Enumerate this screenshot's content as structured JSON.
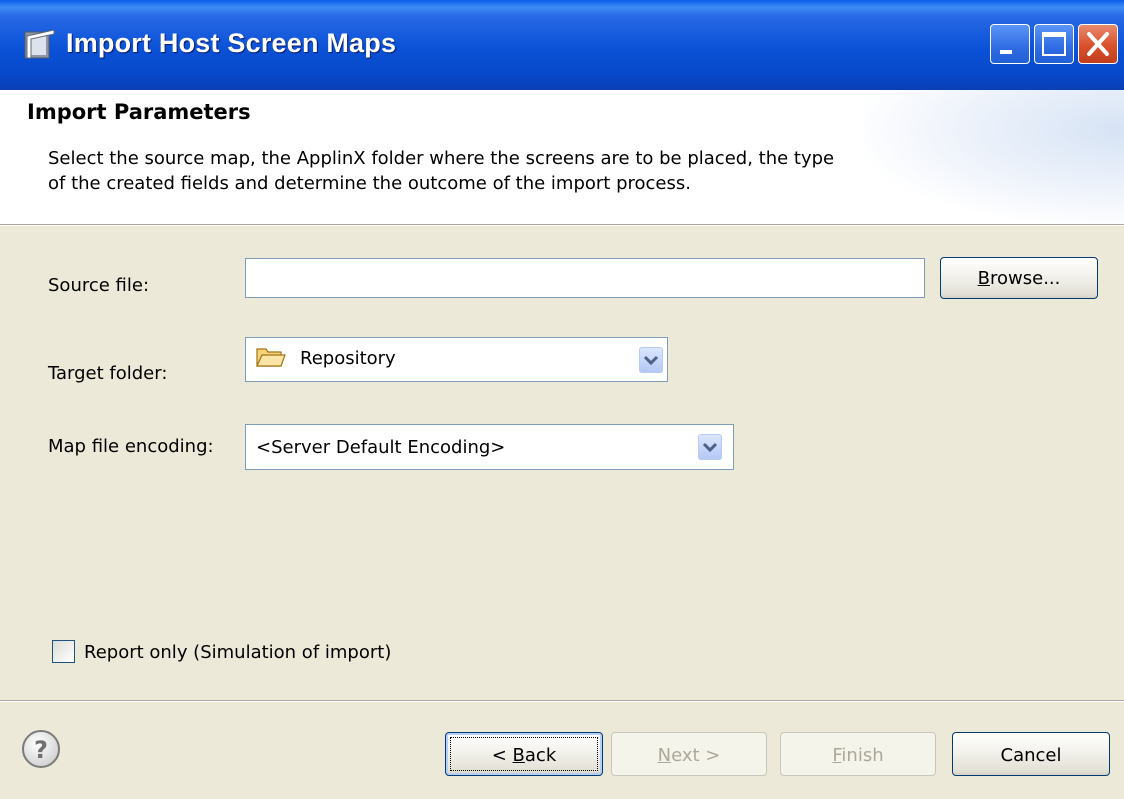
{
  "window": {
    "title": "Import Host Screen Maps"
  },
  "header": {
    "title": "Import Parameters",
    "description_line1": "Select the source map, the ApplinX folder where the screens are to be placed, the type",
    "description_line2": "of the created fields and determine the outcome of the import process."
  },
  "form": {
    "source_file": {
      "label": "Source file:",
      "value": "",
      "browse_label": "Browse..."
    },
    "target_folder": {
      "label": "Target folder:",
      "value": "Repository"
    },
    "map_file_encoding": {
      "label": "Map file encoding:",
      "value": "<Server Default Encoding>"
    },
    "report_only": {
      "label": "Report only (Simulation of import)",
      "checked": false
    }
  },
  "footer": {
    "back_label": "< Back",
    "next_label": "Next >",
    "finish_label": "Finish",
    "cancel_label": "Cancel"
  },
  "colors": {
    "titlebar": "#0a51d6",
    "dialog_bg": "#ece9d8",
    "close_button": "#d9502c"
  },
  "icons": [
    "window-icon",
    "minimize-icon",
    "maximize-icon",
    "close-icon",
    "folder-icon",
    "chevron-down-icon",
    "help-icon"
  ]
}
